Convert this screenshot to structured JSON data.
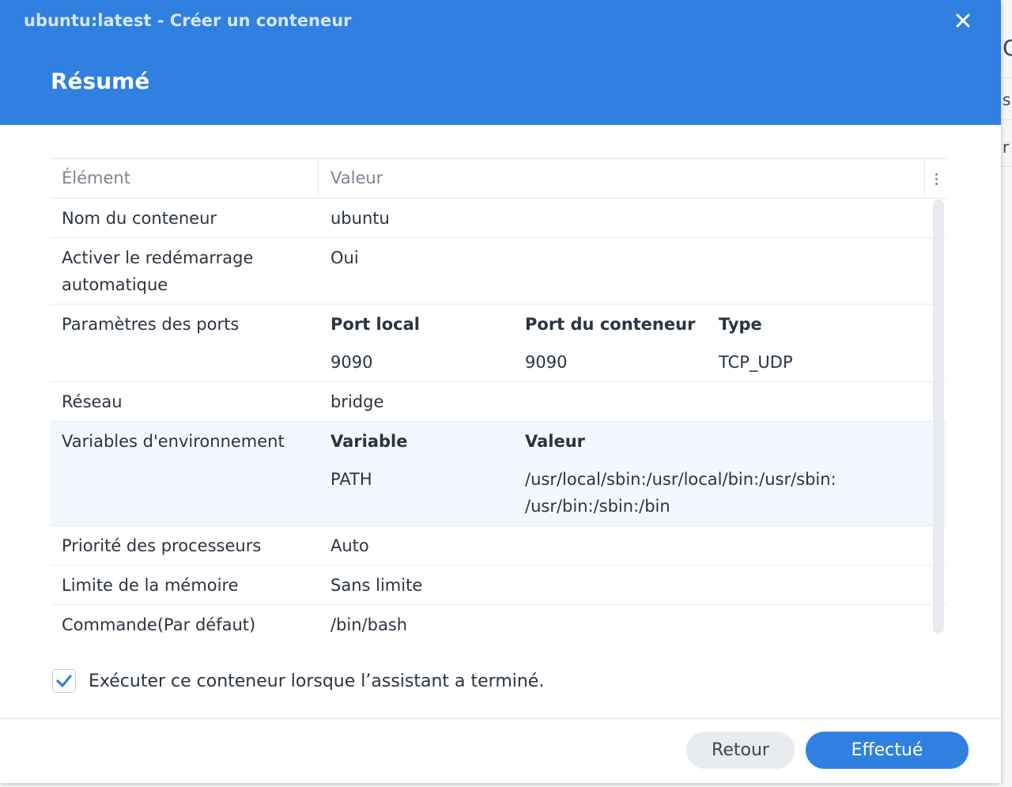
{
  "window": {
    "title": "ubuntu:latest - Créer un conteneur",
    "step_title": "Résumé",
    "close_icon": "close-icon"
  },
  "background_app": {
    "visible_chars": [
      "C",
      "s",
      "r"
    ]
  },
  "table": {
    "headers": {
      "element": "Élément",
      "value": "Valeur"
    },
    "rows": {
      "container_name": {
        "label": "Nom du conteneur",
        "value": "ubuntu"
      },
      "auto_restart": {
        "label": "Activer le redémarrage automatique",
        "value": "Oui"
      },
      "ports": {
        "label": "Paramètres des ports",
        "headers": [
          "Port local",
          "Port du conteneur",
          "Type"
        ],
        "entries": [
          {
            "local": "9090",
            "container": "9090",
            "type": "TCP_UDP"
          }
        ]
      },
      "network": {
        "label": "Réseau",
        "value": "bridge"
      },
      "env": {
        "label": "Variables d'environnement",
        "headers": [
          "Variable",
          "Valeur"
        ],
        "entries": [
          {
            "name": "PATH",
            "value_line1": "/usr/local/sbin:/usr/local/bin:/usr/sbin:",
            "value_line2": "/usr/bin:/sbin:/bin"
          }
        ]
      },
      "cpu_priority": {
        "label": "Priorité des processeurs",
        "value": "Auto"
      },
      "memory_limit": {
        "label": "Limite de la mémoire",
        "value": "Sans limite"
      },
      "command": {
        "label": "Commande(Par défaut)",
        "value": "/bin/bash"
      }
    }
  },
  "run_after": {
    "label": "Exécuter ce conteneur lorsque l’assistant a terminé.",
    "checked": true
  },
  "buttons": {
    "back": "Retour",
    "done": "Effectué"
  },
  "colors": {
    "accent": "#2f80e1",
    "row_highlight": "#f2f8fe",
    "secondary_button": "#e8ecf1"
  }
}
